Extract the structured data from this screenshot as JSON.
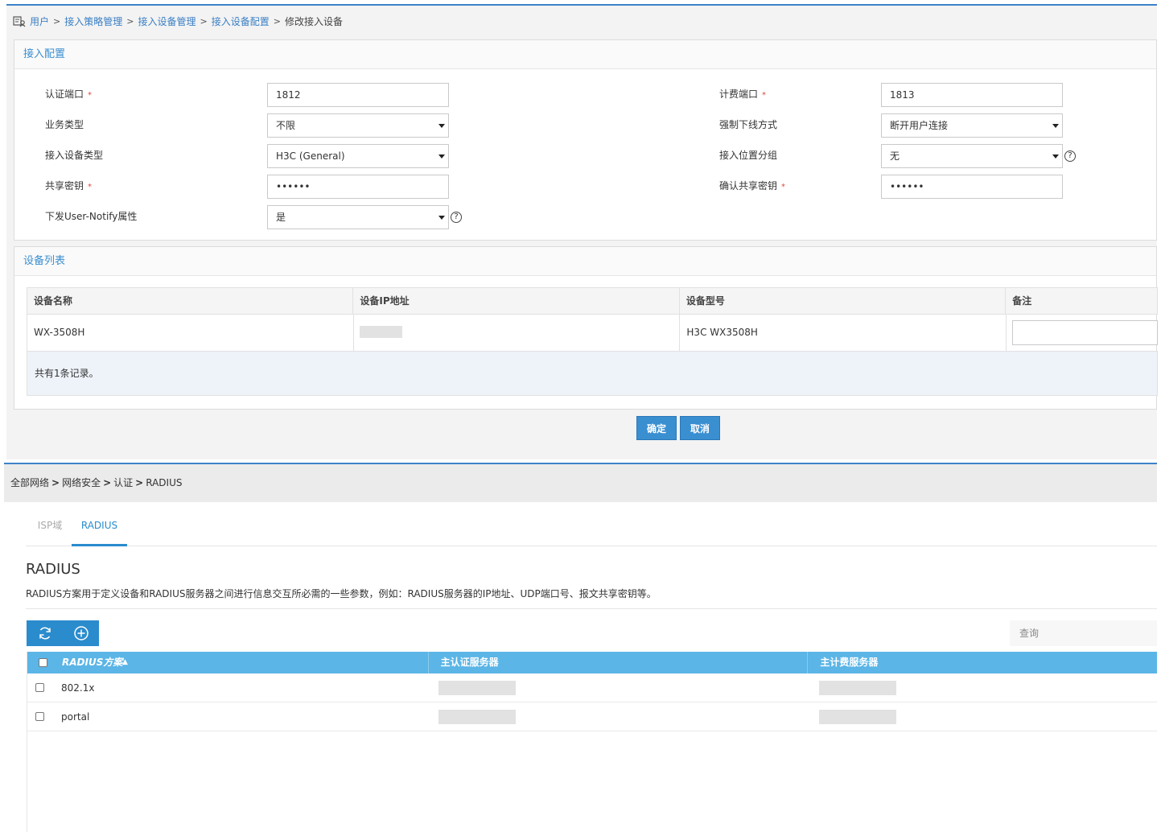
{
  "top": {
    "breadcrumb": [
      "用户",
      "接入策略管理",
      "接入设备管理",
      "接入设备配置"
    ],
    "breadcrumb_current": "修改接入设备",
    "breadcrumb_sep": ">",
    "access_config": {
      "title": "接入配置",
      "auth_port_label": "认证端口",
      "auth_port_value": "1812",
      "acct_port_label": "计费端口",
      "acct_port_value": "1813",
      "service_type_label": "业务类型",
      "service_type_value": "不限",
      "force_offline_label": "强制下线方式",
      "force_offline_value": "断开用户连接",
      "device_type_label": "接入设备类型",
      "device_type_value": "H3C (General)",
      "location_group_label": "接入位置分组",
      "location_group_value": "无",
      "shared_key_label": "共享密钥",
      "shared_key_value": "••••••",
      "confirm_key_label": "确认共享密钥",
      "confirm_key_value": "••••••",
      "user_notify_label": "下发User-Notify属性",
      "user_notify_value": "是",
      "required_mark": "*",
      "help_mark": "?"
    },
    "device_list": {
      "title": "设备列表",
      "columns": [
        "设备名称",
        "设备IP地址",
        "设备型号",
        "备注"
      ],
      "rows": [
        {
          "name": "WX-3508H",
          "ip": "",
          "model": "H3C WX3508H",
          "remark": ""
        }
      ],
      "footer": "共有1条记录。"
    },
    "ok_button": "确定",
    "cancel_button": "取消"
  },
  "bottom": {
    "breadcrumb": [
      "全部网络",
      "网络安全",
      "认证",
      "RADIUS"
    ],
    "breadcrumb_sep": ">",
    "tabs": [
      "ISP域",
      "RADIUS"
    ],
    "active_tab": "RADIUS",
    "heading": "RADIUS",
    "description": "RADIUS方案用于定义设备和RADIUS服务器之间进行信息交互所必需的一些参数，例如：RADIUS服务器的IP地址、UDP端口号、报文共享密钥等。",
    "search_placeholder": "查询",
    "toolbar_icons": [
      "refresh-icon",
      "add-circle-icon"
    ],
    "table": {
      "columns": [
        "RADIUS方案",
        "主认证服务器",
        "主计费服务器"
      ],
      "sort_indicator": "▲",
      "rows": [
        {
          "scheme": "802.1x",
          "auth_server": "",
          "acct_server": ""
        },
        {
          "scheme": "portal",
          "auth_server": "",
          "acct_server": ""
        }
      ]
    }
  },
  "colors": {
    "accent": "#3a8fd1",
    "header_blue": "#5bb5e6",
    "required": "#e0463b"
  }
}
